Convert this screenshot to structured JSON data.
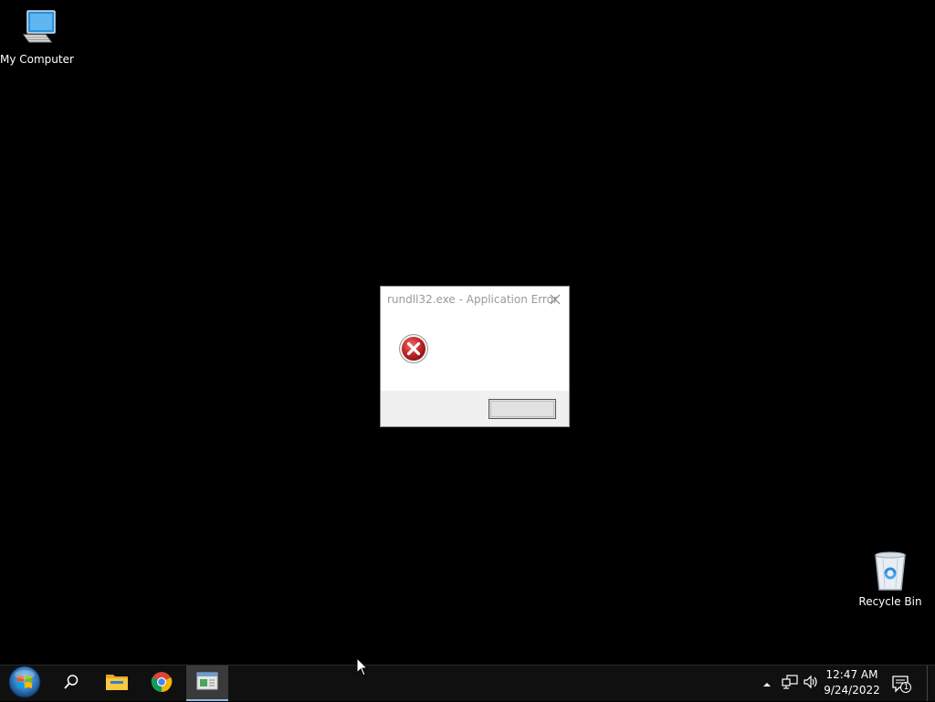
{
  "desktop": {
    "icons": [
      {
        "label": "My Computer",
        "icon": "computer-icon"
      },
      {
        "label": "Recycle Bin",
        "icon": "recycle-bin-icon"
      }
    ]
  },
  "dialog": {
    "title": "rundll32.exe - Application Error",
    "message": "",
    "ok_label": "",
    "icon": "error-icon",
    "close_icon": "close-icon"
  },
  "taskbar": {
    "start_icon": "windows-start-icon",
    "search_icon": "search-icon",
    "pinned": [
      {
        "name": "file-explorer",
        "icon": "folder-icon"
      },
      {
        "name": "chrome",
        "icon": "chrome-icon"
      },
      {
        "name": "active-app",
        "icon": "window-app-icon"
      }
    ],
    "tray": {
      "chevron_icon": "chevron-up-icon",
      "network_icon": "network-icon",
      "volume_icon": "volume-icon",
      "time": "12:47 AM",
      "date": "9/24/2022",
      "notifications_count": "1",
      "notifications_icon": "action-center-icon"
    }
  },
  "colors": {
    "desktop_bg": "#000000",
    "taskbar_bg": "#101010",
    "dialog_footer": "#f0f0f0",
    "error_red": "#c62828",
    "accent": "#8fb8e8"
  }
}
